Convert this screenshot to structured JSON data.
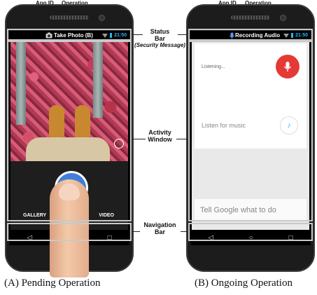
{
  "top_labels": {
    "left_app_id": "App ID",
    "left_operation": "Operation",
    "right_app_id": "App ID",
    "right_operation": "Operation"
  },
  "phone_a": {
    "status_text": "Take Photo (B)",
    "status_time": "21:50",
    "camera_labels": {
      "gallery": "GALLERY",
      "video": "VIDEO"
    },
    "nav": {
      "back": "◁",
      "home": "○",
      "recent": "□"
    }
  },
  "phone_b": {
    "status_text": "Recording Audio",
    "status_time": "21:50",
    "listening_text": "Listening...",
    "listen_music_text": "Listen for music",
    "search_placeholder": "Tell Google what to do",
    "nav": {
      "back": "◁",
      "home": "○",
      "recent": "□"
    }
  },
  "callouts": {
    "status_bar_line1": "Status",
    "status_bar_line2": "Bar",
    "status_bar_sub": "(Security Message)",
    "activity_line1": "Activity",
    "activity_line2": "Window",
    "nav_line1": "Navigation",
    "nav_line2": "Bar"
  },
  "captions": {
    "a": "(A) Pending Operation",
    "b": "(B) Ongoing Operation"
  },
  "colors": {
    "mic_button": "#e53935",
    "status_time": "#29b6f6",
    "shutter_blue": "#3f7fd9"
  },
  "icons": [
    "camera-icon",
    "mic-icon",
    "wifi-icon",
    "battery-icon",
    "music-note-icon",
    "back-icon",
    "home-icon",
    "recent-apps-icon",
    "shutter-icon"
  ]
}
